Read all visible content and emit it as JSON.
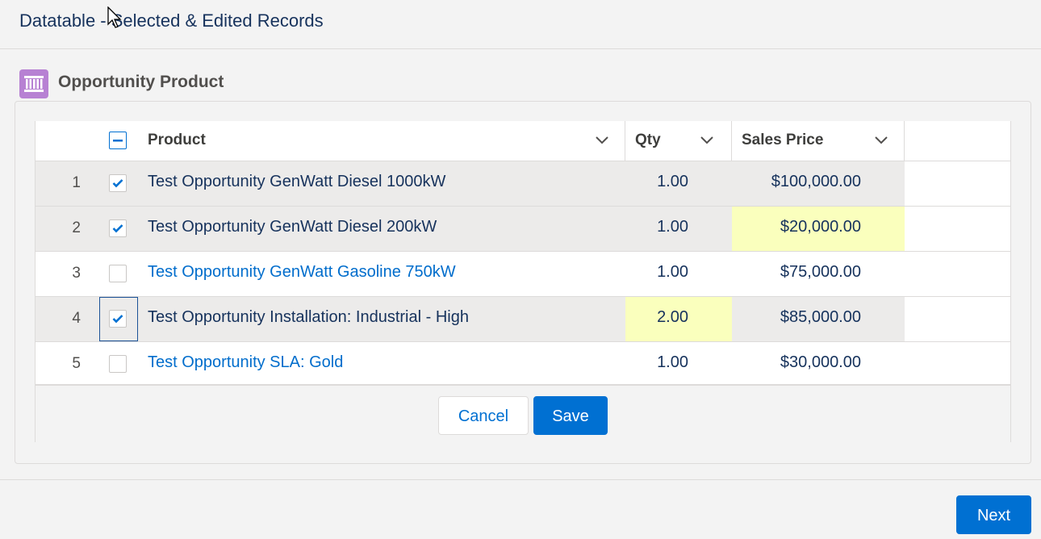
{
  "header": {
    "title": "Datatable - Selected & Edited Records"
  },
  "card": {
    "title": "Opportunity Product",
    "icon": "product-icon"
  },
  "table": {
    "columns": [
      {
        "label": "Product"
      },
      {
        "label": "Qty"
      },
      {
        "label": "Sales Price"
      }
    ],
    "rows": [
      {
        "num": "1",
        "product": "Test Opportunity GenWatt Diesel 1000kW",
        "qty": "1.00",
        "price": "$100,000.00",
        "selected": true
      },
      {
        "num": "2",
        "product": "Test Opportunity GenWatt Diesel 200kW",
        "qty": "1.00",
        "price": "$20,000.00",
        "selected": true
      },
      {
        "num": "3",
        "product": "Test Opportunity GenWatt Gasoline 750kW",
        "qty": "1.00",
        "price": "$75,000.00",
        "selected": false
      },
      {
        "num": "4",
        "product": "Test Opportunity Installation: Industrial - High",
        "qty": "2.00",
        "price": "$85,000.00",
        "selected": true
      },
      {
        "num": "5",
        "product": "Test Opportunity SLA: Gold",
        "qty": "1.00",
        "price": "$30,000.00",
        "selected": false
      }
    ]
  },
  "actions": {
    "cancel_label": "Cancel",
    "save_label": "Save"
  },
  "nav": {
    "next_label": "Next"
  },
  "colors": {
    "brand": "#0070d2",
    "edited_cell": "#faffbd",
    "selected_row": "#ecebea"
  }
}
